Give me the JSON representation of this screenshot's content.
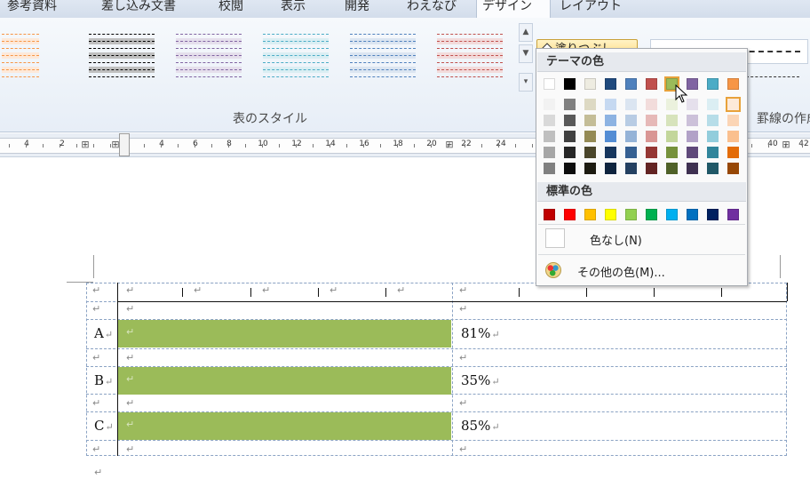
{
  "ribbon_tabs": [
    "参考資料",
    "差し込み文書",
    "校閲",
    "表示",
    "開発",
    "わえなび",
    "デザイン",
    "レイアウト"
  ],
  "ribbon": {
    "group_label": "表のスタイル",
    "group_label2": "罫線の作成",
    "fill_button_label": "塗りつぶし",
    "chevron": "▾"
  },
  "ruler": {
    "numbers": [
      "4",
      "2",
      "4",
      "6",
      "8",
      "10",
      "12",
      "14",
      "16",
      "18",
      "20",
      "22",
      "24",
      "40",
      "42"
    ]
  },
  "dropdown": {
    "theme_header": "テーマの色",
    "standard_header": "標準の色",
    "no_color_label": "色なし(N)",
    "more_colors_label": "その他の色(M)...",
    "theme_colors": [
      "#ffffff",
      "#000000",
      "#eeece1",
      "#1f497d",
      "#4f81bd",
      "#c0504d",
      "#9bbb59",
      "#8064a2",
      "#4bacc6",
      "#f79646"
    ],
    "selected_theme_index": 6,
    "shades": [
      [
        "#f2f2f2",
        "#d9d9d9",
        "#bfbfbf",
        "#a6a6a6",
        "#808080"
      ],
      [
        "#808080",
        "#595959",
        "#404040",
        "#262626",
        "#0d0d0d"
      ],
      [
        "#ddd9c3",
        "#c4bd97",
        "#948a54",
        "#4a452a",
        "#1d1b11"
      ],
      [
        "#c6d9f1",
        "#8db3e2",
        "#548dd4",
        "#17365d",
        "#0f243e"
      ],
      [
        "#dbe5f1",
        "#b8cce4",
        "#95b3d7",
        "#366092",
        "#244061"
      ],
      [
        "#f2dcdb",
        "#e6b9b8",
        "#d99694",
        "#953734",
        "#632423"
      ],
      [
        "#ebf1dd",
        "#d7e3bc",
        "#c3d69b",
        "#76923c",
        "#4f6128"
      ],
      [
        "#e5e0ec",
        "#ccc1d9",
        "#b2a2c7",
        "#5f497a",
        "#3f3151"
      ],
      [
        "#dbeef3",
        "#b7dde8",
        "#92cddc",
        "#31859b",
        "#205867"
      ],
      [
        "#fdeada",
        "#fbd5b5",
        "#fac08f",
        "#e36c09",
        "#974806"
      ]
    ],
    "standard_colors": [
      "#c00000",
      "#ff0000",
      "#ffc000",
      "#ffff00",
      "#92d050",
      "#00b050",
      "#00b0f0",
      "#0070c0",
      "#002060",
      "#7030a0"
    ]
  },
  "document": {
    "paragraph_mark": "↵",
    "rows": [
      {
        "label": "A",
        "value": "81%"
      },
      {
        "label": "B",
        "value": "35%"
      },
      {
        "label": "C",
        "value": "85%"
      }
    ],
    "bar_color": "#9bbb59"
  }
}
